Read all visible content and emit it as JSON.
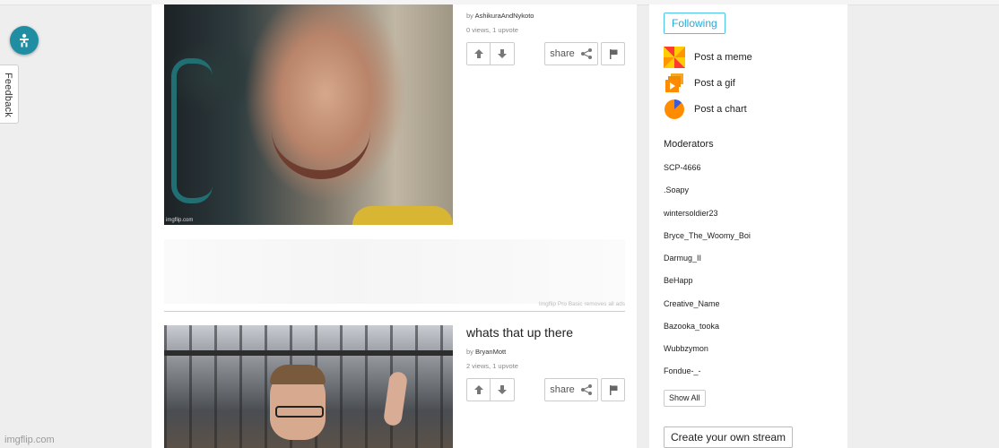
{
  "page": {
    "watermark": "imgflip.com"
  },
  "feedback": {
    "label": "Feedback"
  },
  "posts": [
    {
      "title": "",
      "by_label": "by",
      "author": "AshikuraAndNykoto",
      "stats": "0 views, 1 upvote",
      "share_label": "share",
      "image_credit": "imgflip.com"
    },
    {
      "title": "whats that up there",
      "by_label": "by",
      "author": "BryanMott",
      "stats": "2 views, 1 upvote",
      "share_label": "share"
    }
  ],
  "ad": {
    "note": "Imgflip Pro Basic removes all ads"
  },
  "sidebar": {
    "following_label": "Following",
    "actions": [
      {
        "label": "Post a meme",
        "icon": "meme-pinwheel-icon"
      },
      {
        "label": "Post a gif",
        "icon": "gif-frames-icon"
      },
      {
        "label": "Post a chart",
        "icon": "pie-chart-icon"
      }
    ],
    "moderators_heading": "Moderators",
    "moderators": [
      "SCP-4666",
      ".Soapy",
      "wintersoldier23",
      "Bryce_The_Woomy_Boi",
      "Darmug_II",
      "BeHapp",
      "Creative_Name",
      "Bazooka_tooka",
      "Wubbzymon",
      "Fondue-_-"
    ],
    "show_all_label": "Show All",
    "create_stream_label": "Create your own stream"
  },
  "colors": {
    "accent": "#28a9d6",
    "accessibility_bg": "#1f8ea3",
    "chart_orange": "#ff8c00"
  }
}
